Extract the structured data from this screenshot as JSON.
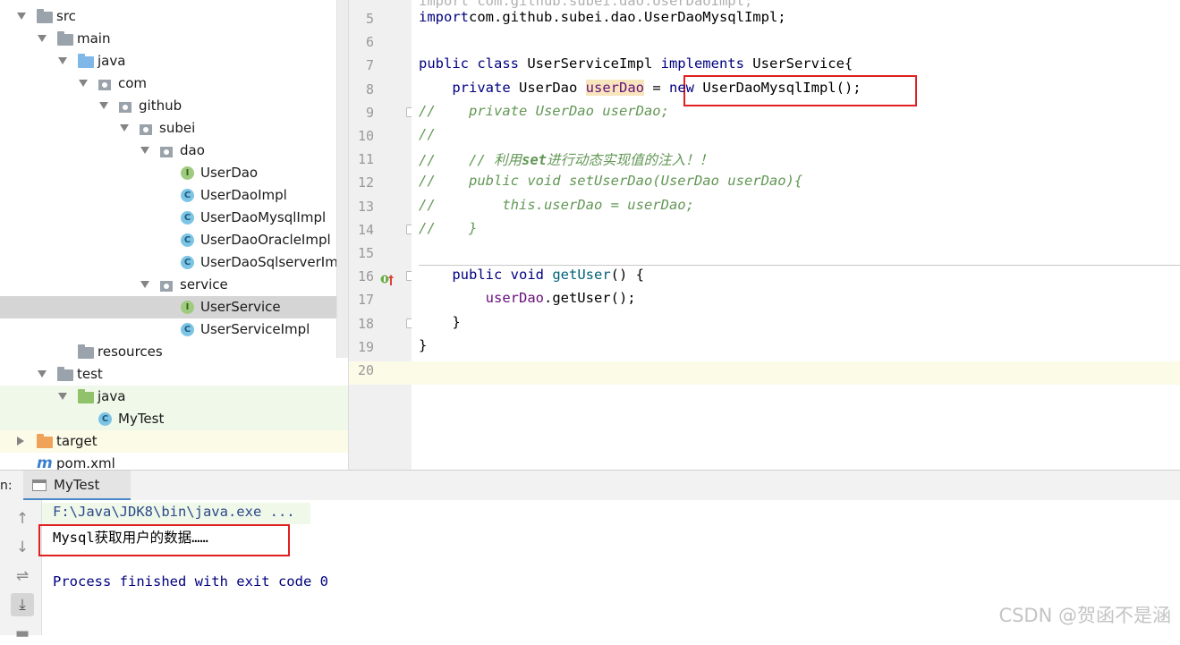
{
  "tree": {
    "items": [
      {
        "label": "src",
        "kind": "folder-gray",
        "depth": 1,
        "open": true
      },
      {
        "label": "main",
        "kind": "folder-gray",
        "depth": 2,
        "open": true
      },
      {
        "label": "java",
        "kind": "folder-blue",
        "depth": 3,
        "open": true
      },
      {
        "label": "com",
        "kind": "package",
        "depth": 4,
        "open": true
      },
      {
        "label": "github",
        "kind": "package",
        "depth": 5,
        "open": true
      },
      {
        "label": "subei",
        "kind": "package",
        "depth": 6,
        "open": true
      },
      {
        "label": "dao",
        "kind": "package",
        "depth": 7,
        "open": true
      },
      {
        "label": "UserDao",
        "kind": "interface",
        "depth": 8
      },
      {
        "label": "UserDaoImpl",
        "kind": "class",
        "depth": 8
      },
      {
        "label": "UserDaoMysqlImpl",
        "kind": "class",
        "depth": 8
      },
      {
        "label": "UserDaoOracleImpl",
        "kind": "class",
        "depth": 8
      },
      {
        "label": "UserDaoSqlserverIm",
        "kind": "class",
        "depth": 8
      },
      {
        "label": "service",
        "kind": "package",
        "depth": 7,
        "open": true
      },
      {
        "label": "UserService",
        "kind": "interface",
        "depth": 8,
        "selected": true
      },
      {
        "label": "UserServiceImpl",
        "kind": "class",
        "depth": 8
      },
      {
        "label": "resources",
        "kind": "resources",
        "depth": 3
      },
      {
        "label": "test",
        "kind": "folder-gray",
        "depth": 2,
        "open": true
      },
      {
        "label": "java",
        "kind": "folder-green",
        "depth": 3,
        "open": true,
        "test": true
      },
      {
        "label": "MyTest",
        "kind": "class-test",
        "depth": 4,
        "test": true
      },
      {
        "label": "target",
        "kind": "folder-orange",
        "depth": 1,
        "open": false,
        "target": true
      },
      {
        "label": "pom.xml",
        "kind": "maven",
        "depth": 1
      }
    ],
    "icon_letters": {
      "interface": "I",
      "class": "C",
      "maven": "m"
    }
  },
  "editor": {
    "lines": [
      {
        "n": "5",
        "tokens": [
          [
            "kw",
            "import"
          ],
          [
            "",
            "com.github.subei.dao.UserDaoMysqlImpl;"
          ]
        ]
      },
      {
        "n": "6",
        "tokens": []
      },
      {
        "n": "7",
        "tokens": [
          [
            "kw",
            "public class"
          ],
          [
            "",
            " UserServiceImpl "
          ],
          [
            "kw",
            "implements"
          ],
          [
            "",
            " UserService{"
          ]
        ]
      },
      {
        "n": "8",
        "tokens": [
          [
            "",
            "    "
          ],
          [
            "kw",
            "private"
          ],
          [
            "",
            " UserDao "
          ],
          [
            "fld hl",
            "userDao"
          ],
          [
            "",
            " = "
          ],
          [
            "kw",
            "new"
          ],
          [
            "",
            " UserDaoMysqlImpl();"
          ]
        ]
      },
      {
        "n": "9",
        "tokens": [
          [
            "cm",
            "//    private UserDao userDao;"
          ]
        ]
      },
      {
        "n": "10",
        "tokens": [
          [
            "cm",
            "//"
          ]
        ]
      },
      {
        "n": "11",
        "tokens": [
          [
            "cm",
            "//    // 利用"
          ],
          [
            "cm-kw",
            "set"
          ],
          [
            "cm",
            "进行动态实现值的注入！！"
          ]
        ]
      },
      {
        "n": "12",
        "tokens": [
          [
            "cm",
            "//    public void setUserDao(UserDao userDao){"
          ]
        ]
      },
      {
        "n": "13",
        "tokens": [
          [
            "cm",
            "//        this.userDao = userDao;"
          ]
        ]
      },
      {
        "n": "14",
        "tokens": [
          [
            "cm",
            "//    }"
          ]
        ]
      },
      {
        "n": "15",
        "tokens": []
      },
      {
        "n": "16",
        "tokens": [
          [
            "",
            "    "
          ],
          [
            "kw",
            "public void"
          ],
          [
            "",
            " "
          ],
          [
            "method",
            "getUser"
          ],
          [
            "",
            "() {"
          ]
        ]
      },
      {
        "n": "17",
        "tokens": [
          [
            "",
            "        "
          ],
          [
            "fld",
            "userDao"
          ],
          [
            "",
            ".getUser();"
          ]
        ]
      },
      {
        "n": "18",
        "tokens": [
          [
            "",
            "    }"
          ]
        ]
      },
      {
        "n": "19",
        "tokens": [
          [
            "",
            "}"
          ]
        ]
      },
      {
        "n": "20",
        "tokens": []
      }
    ],
    "partial_top_line": "import com.github.subei.dao.UserDaoImpl;"
  },
  "run": {
    "label": "n:",
    "tab_label": "MyTest",
    "console_lines": [
      {
        "text": "F:\\Java\\JDK8\\bin\\java.exe ...",
        "color": "#2b4a8a"
      },
      {
        "text": "Mysql获取用户的数据……",
        "color": "#000000"
      },
      {
        "text": "",
        "color": "#000000"
      },
      {
        "text": "Process finished with exit code 0",
        "color": "#000080"
      }
    ]
  },
  "watermark": "CSDN @贺函不是涵",
  "colors": {
    "highlight_box": "#e02020",
    "keyword": "#000080",
    "comment": "#629755",
    "field": "#660e7a"
  }
}
